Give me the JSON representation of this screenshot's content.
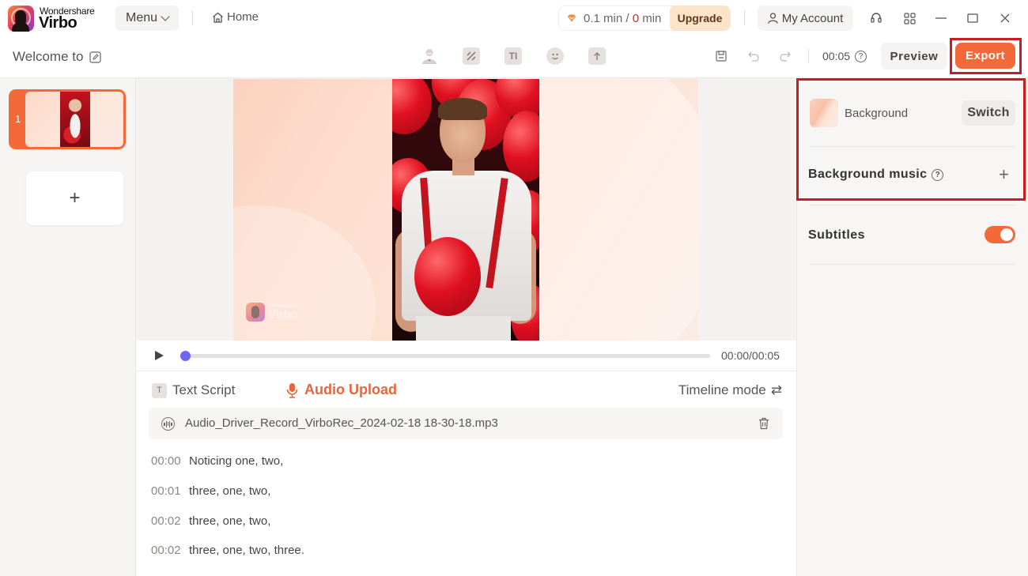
{
  "app": {
    "brand_top": "Wondershare",
    "brand_name": "Virbo",
    "menu_label": "Menu",
    "home_label": "Home",
    "usage": {
      "used": "0.1 min",
      "separator": " / ",
      "remaining": "0",
      "remaining_unit": " min"
    },
    "upgrade_label": "Upgrade",
    "account_label": "My Account",
    "window_controls": [
      "headset-icon",
      "apps-grid-icon",
      "minimize-icon",
      "maximize-icon",
      "close-icon"
    ]
  },
  "toolbar": {
    "project_title": "Welcome to",
    "tools": [
      "avatar-icon",
      "transition-icon",
      "text-icon",
      "sticker-icon",
      "upload-icon"
    ],
    "duration": "00:05",
    "help": "?",
    "preview_label": "Preview",
    "export_label": "Export"
  },
  "slides": {
    "items": [
      {
        "number": "1",
        "selected": true
      }
    ],
    "add_label": "+"
  },
  "canvas": {
    "watermark_top": "Wondershare",
    "watermark": "Virbo"
  },
  "player": {
    "time": "00:00/00:05",
    "progress": 0.0
  },
  "script": {
    "tab_text": "Text Script",
    "tab_text_icon": "T",
    "tab_audio": "Audio Upload",
    "timeline_mode": "Timeline mode",
    "timeline_icon": "⇄",
    "file_name": "Audio_Driver_Record_VirboRec_2024-02-18 18-30-18.mp3",
    "lines": [
      {
        "time": "00:00",
        "text": "Noticing one, two,"
      },
      {
        "time": "00:01",
        "text": "three, one, two,"
      },
      {
        "time": "00:02",
        "text": "three, one, two,"
      },
      {
        "time": "00:02",
        "text": "three, one, two, three."
      }
    ]
  },
  "props": {
    "background_label": "Background",
    "switch_label": "Switch",
    "bg_music_label": "Background music",
    "bg_music_help": "?",
    "bg_music_add": "+",
    "subtitles_label": "Subtitles",
    "subtitles_on": true
  },
  "colors": {
    "accent": "#f4693a",
    "highlight_box": "#c81e1e",
    "progress": "#6f66f0",
    "upgrade_bg": "#fde3c8"
  }
}
